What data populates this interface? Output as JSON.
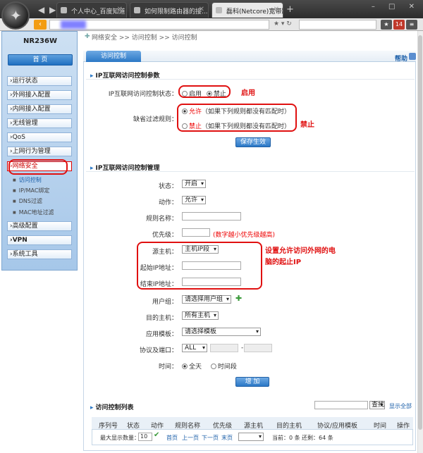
{
  "browser": {
    "tabs": [
      {
        "title": "个人中心_百度知道"
      },
      {
        "title": "如何限制路由器的接..."
      },
      {
        "title": "磊科(Netcore)宽带路"
      }
    ],
    "new_tab": "+",
    "window_controls": "– □ ✕",
    "toolbar_badge": "14"
  },
  "sidebar": {
    "model": "NR236W",
    "home_label": "首 页",
    "items": [
      {
        "label": "›运行状态"
      },
      {
        "label": "›外网接入配置"
      },
      {
        "label": "›内网接入配置"
      },
      {
        "label": "›无线管理"
      },
      {
        "label": "›QoS"
      },
      {
        "label": "›上网行为管理"
      },
      {
        "label": "›网络安全"
      },
      {
        "label": "›高级配置"
      },
      {
        "label": "›VPN"
      },
      {
        "label": "›系统工具"
      }
    ],
    "subitems": [
      {
        "label": "访问控制"
      },
      {
        "label": "IP/MAC绑定"
      },
      {
        "label": "DNS过滤"
      },
      {
        "label": "MAC地址过滤"
      }
    ]
  },
  "breadcrumb": "网络安全 >> 访问控制 >> 访问控制",
  "page_tab": "访问控制",
  "help_label": "帮助",
  "params": {
    "title": "IP互联网访问控制参数",
    "status_label": "IP互联网访问控制状态：",
    "status_on": "启用",
    "status_off": "禁止",
    "default_label": "缺省过滤规则：",
    "allow_text": "允许",
    "allow_note": "（如果下列规则都没有匹配时）",
    "deny_text": "禁止",
    "deny_note": "（如果下列规则都没有匹配时）",
    "save_button": "保存生效"
  },
  "mgmt": {
    "title": "IP互联网访问控制管理",
    "state_label": "状态：",
    "state_value": "开启",
    "action_label": "动作：",
    "action_value": "允许",
    "rule_name_label": "规则名称：",
    "priority_label": "优先级：",
    "priority_note": "(数字越小优先级越高)",
    "src_host_label": "源主机：",
    "src_host_value": "主机IP段",
    "start_ip_label": "起始IP地址：",
    "end_ip_label": "结束IP地址：",
    "user_group_label": "用户组：",
    "user_group_value": "请选择用户组",
    "dst_host_label": "目的主机：",
    "dst_host_value": "所有主机",
    "app_tpl_label": "应用模板：",
    "app_tpl_value": "请选择模板",
    "proto_label": "协议及端口：",
    "proto_value": "ALL",
    "port_sep": "-",
    "time_label": "时间：",
    "time_all": "全天",
    "time_period": "时间段",
    "add_button": "增 加"
  },
  "annotations": {
    "enable": "启用",
    "deny": "禁止",
    "note_line1": "设置允许访问外网的电",
    "note_line2": "脑的起止IP"
  },
  "list": {
    "title": "访问控制列表",
    "search_button": "查找",
    "show_all": "显示全部",
    "columns": [
      "序列号",
      "状态",
      "动作",
      "规则名称",
      "优先级",
      "源主机",
      "目的主机",
      "协议/应用模板",
      "时间",
      "操作"
    ],
    "footer": {
      "max_label": "最大显示数量：",
      "max_value": "10",
      "first": "首页",
      "prev": "上一页",
      "next": "下一页",
      "last": "末页",
      "current": "当前：0 条",
      "total": "还剩：64 条"
    }
  },
  "colors": {
    "accent_blue": "#2b78c6",
    "annotation_red": "#e01010"
  }
}
